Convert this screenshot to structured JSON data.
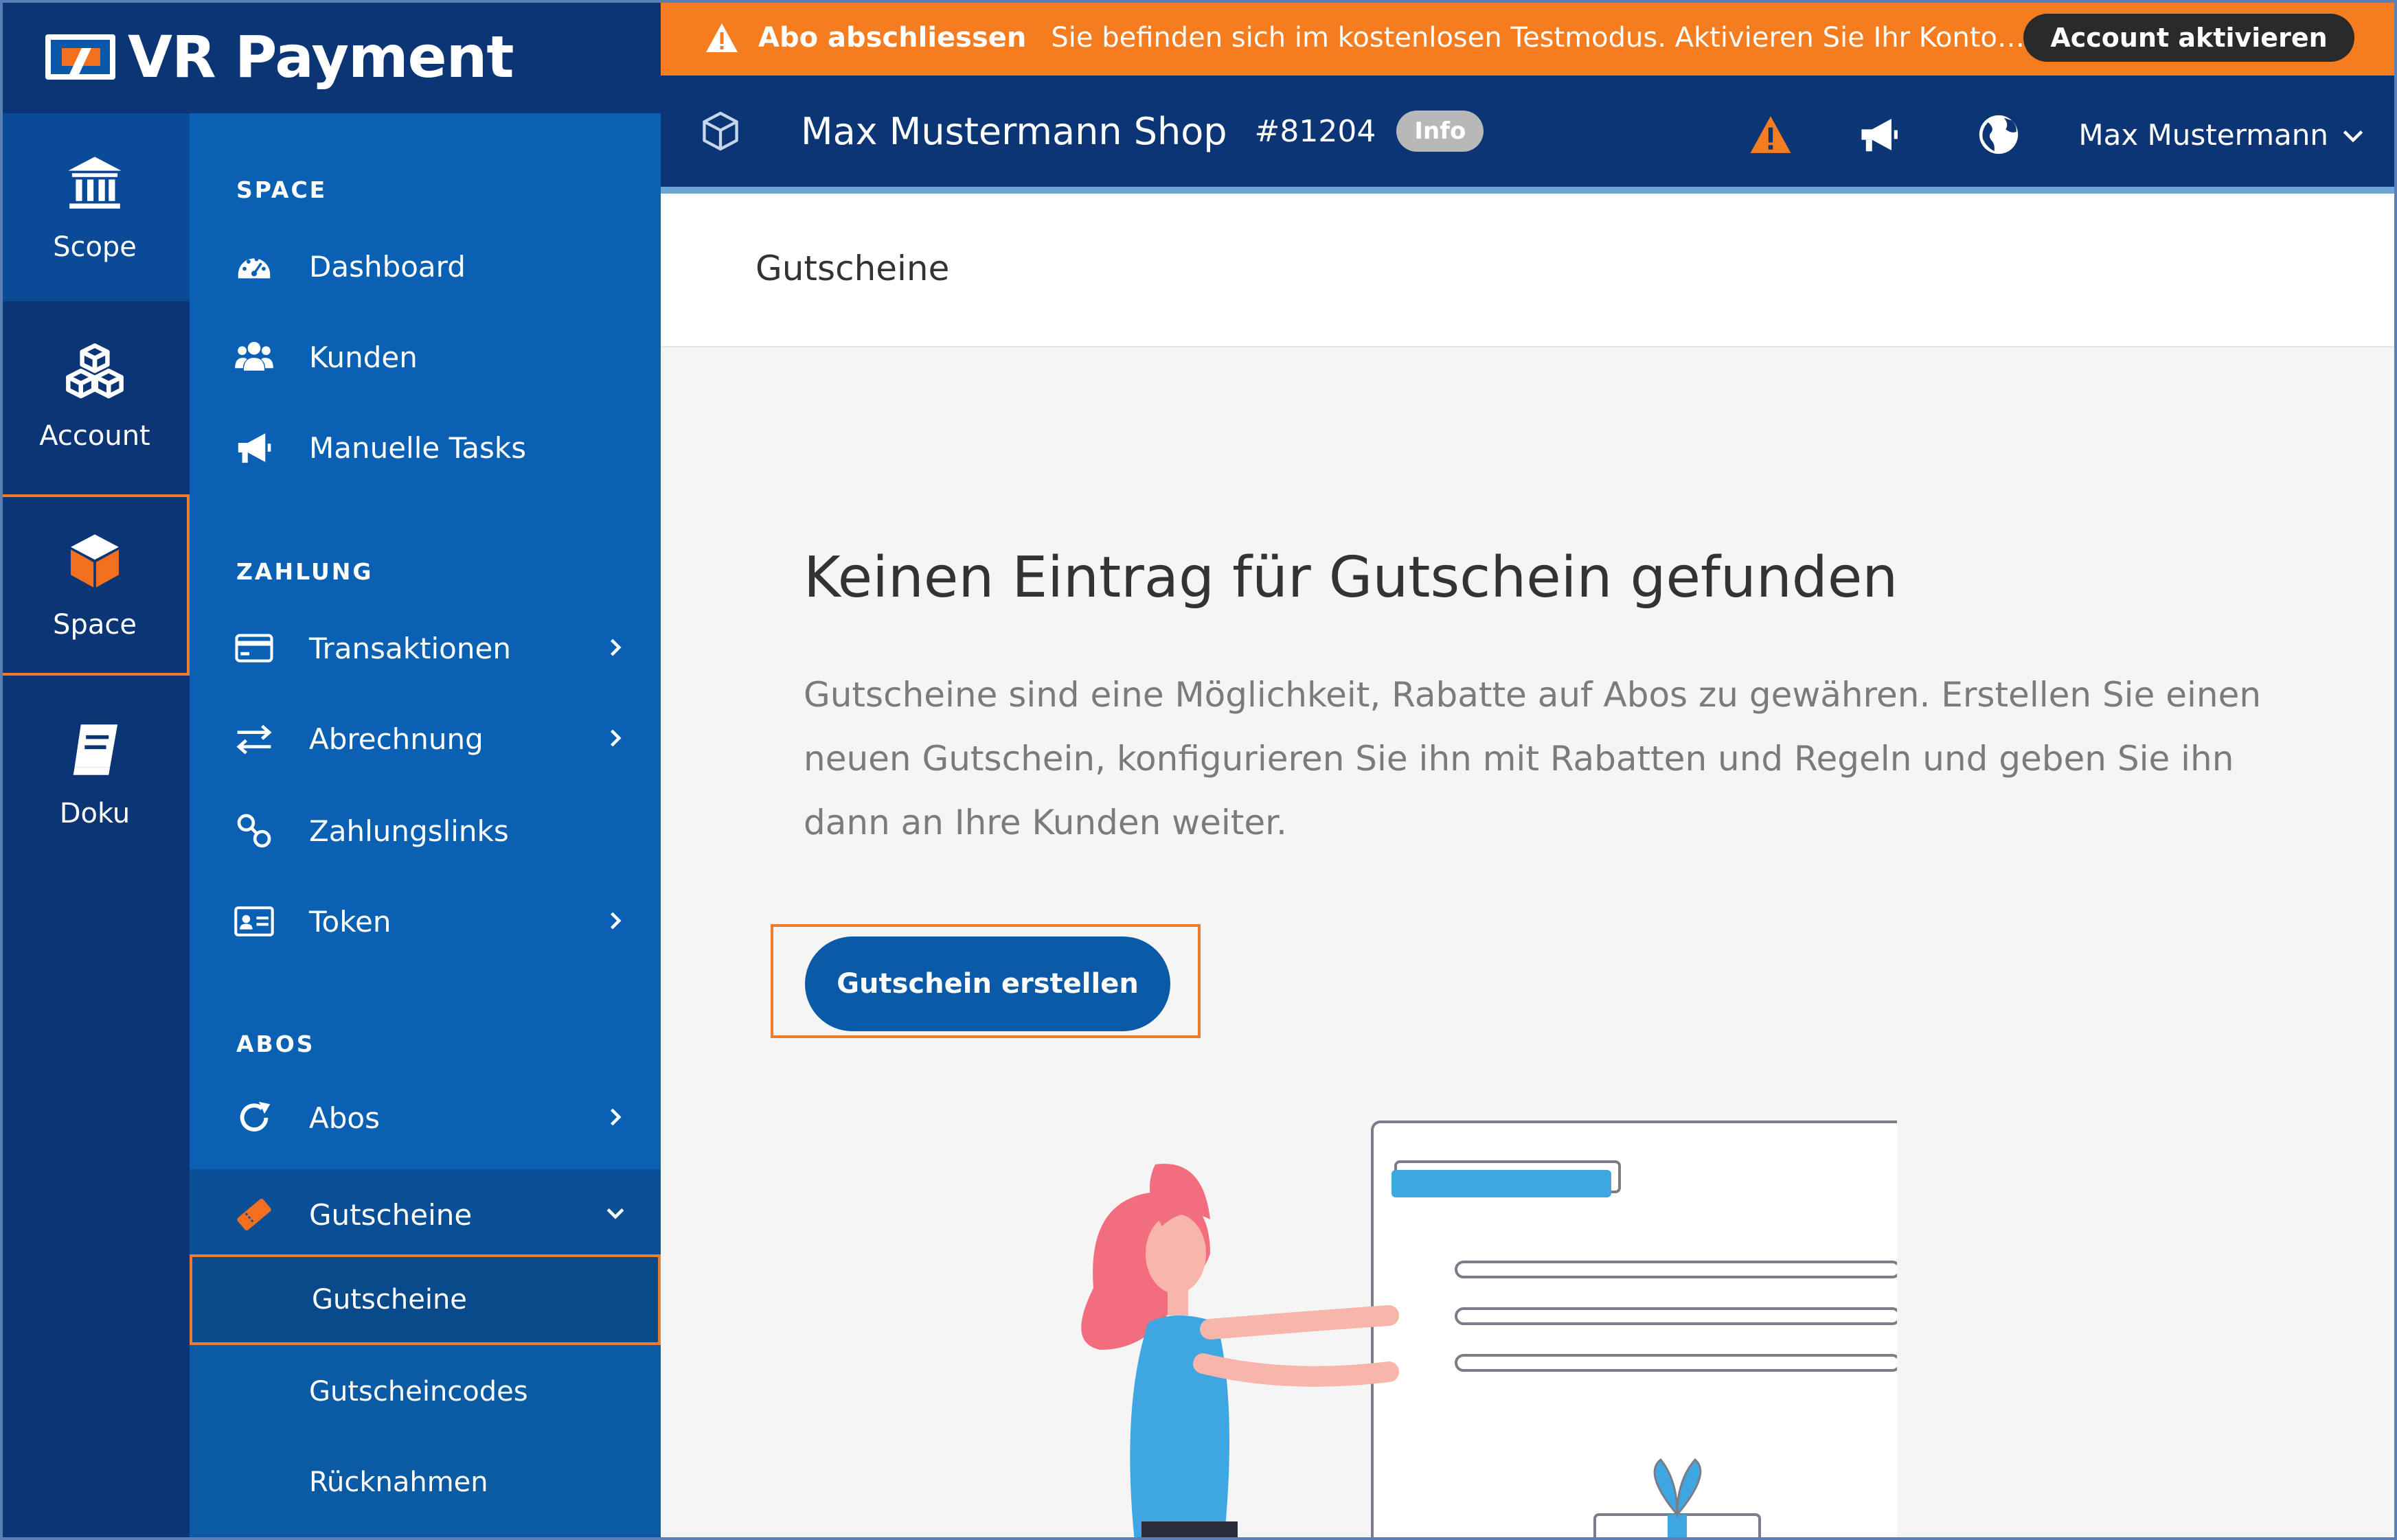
{
  "brand": {
    "name": "VR Payment"
  },
  "rail": {
    "items": [
      {
        "label": "Scope",
        "icon": "bank-icon"
      },
      {
        "label": "Account",
        "icon": "cubes-icon"
      },
      {
        "label": "Space",
        "icon": "cube-icon",
        "active": true
      },
      {
        "label": "Doku",
        "icon": "book-icon"
      }
    ]
  },
  "sidenav": {
    "sections": [
      {
        "title": "SPACE",
        "items": [
          {
            "label": "Dashboard",
            "icon": "dashboard-icon"
          },
          {
            "label": "Kunden",
            "icon": "users-icon"
          },
          {
            "label": "Manuelle Tasks",
            "icon": "megaphone-icon"
          }
        ]
      },
      {
        "title": "ZAHLUNG",
        "items": [
          {
            "label": "Transaktionen",
            "icon": "credit-card-icon",
            "expandable": true
          },
          {
            "label": "Abrechnung",
            "icon": "exchange-icon",
            "expandable": true
          },
          {
            "label": "Zahlungslinks",
            "icon": "link-icon"
          },
          {
            "label": "Token",
            "icon": "id-card-icon",
            "expandable": true
          }
        ]
      },
      {
        "title": "ABOS",
        "items": [
          {
            "label": "Abos",
            "icon": "refresh-icon",
            "expandable": true
          },
          {
            "label": "Gutscheine",
            "icon": "ticket-icon",
            "expanded": true,
            "children": [
              {
                "label": "Gutscheine",
                "active": true
              },
              {
                "label": "Gutscheincodes"
              },
              {
                "label": "Rücknahmen"
              }
            ]
          }
        ]
      }
    ]
  },
  "banner": {
    "title": "Abo abschliessen",
    "message": "Sie befinden sich im kostenlosen Testmodus. Aktivieren Sie Ihr Konto, so...",
    "button": "Account aktivieren",
    "color": "#f57c1f"
  },
  "header": {
    "shop": "Max Mustermann Shop",
    "number": "#81204",
    "pill": "Info",
    "user": "Max Mustermann",
    "icons": [
      "warning-icon",
      "megaphone-icon",
      "globe-icon"
    ]
  },
  "page": {
    "title": "Gutscheine",
    "empty_title": "Keinen Eintrag für Gutschein gefunden",
    "empty_desc": "Gutscheine sind eine Möglichkeit, Rabatte auf Abos zu gewähren. Erstellen Sie einen neuen Gutschein, konfigurieren Sie ihn mit Rabatten und Regeln und geben Sie ihn dann an Ihre Kunden weiter.",
    "cta": "Gutschein erstellen"
  },
  "colors": {
    "rail": "#0c3575",
    "sidenav": "#0a60b2",
    "accent": "#ef7b2b",
    "primary_button": "#0a5aa8"
  }
}
